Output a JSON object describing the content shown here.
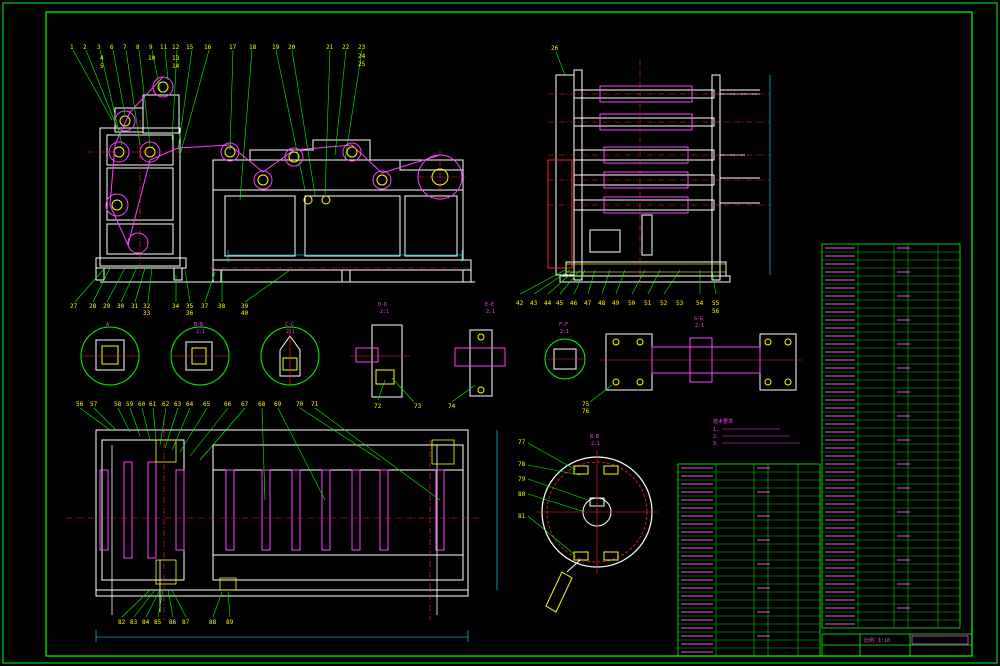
{
  "colors": {
    "background": "#000000",
    "frame": "#00ff00",
    "part": "#ffffff",
    "center": "#ff2020",
    "leader": "#00ff00",
    "number": "#ffff00",
    "note": "#ff40ff",
    "table_text": "#ff40ff",
    "shaft": "#ff40ff",
    "bolt": "#ffff00",
    "dim": "#00ffff"
  },
  "front_view_numbers": [
    "1",
    "2",
    "3",
    "4",
    "5",
    "6",
    "7",
    "8",
    "9",
    "10",
    "11",
    "12",
    "13",
    "14",
    "15",
    "16",
    "17",
    "18",
    "19",
    "20",
    "21",
    "22",
    "23",
    "24",
    "25"
  ],
  "front_view_bottom_numbers": [
    "27",
    "28",
    "29",
    "30",
    "31",
    "32",
    "33",
    "34",
    "35",
    "36",
    "37",
    "38",
    "39",
    "40"
  ],
  "side_view_number": "26",
  "side_view_bottom_numbers": [
    "42",
    "43",
    "44",
    "45",
    "46",
    "47",
    "48",
    "49",
    "50",
    "51",
    "52",
    "53",
    "54",
    "55",
    "56"
  ],
  "detail_views": [
    {
      "label": "A",
      "scale": "2:1"
    },
    {
      "label": "B-B",
      "scale": "2:1"
    },
    {
      "label": "C-C",
      "scale": "2:1"
    },
    {
      "label": "D-D",
      "scale": "2:1"
    },
    {
      "label": "E-E",
      "scale": "2:1"
    },
    {
      "label": "F-F",
      "scale": "2:1"
    },
    {
      "label": "G-G",
      "scale": "2:1"
    }
  ],
  "detail_numbers": [
    "72",
    "73",
    "74",
    "75",
    "76"
  ],
  "top_view_numbers": [
    "56",
    "57",
    "58",
    "59",
    "60",
    "61",
    "62",
    "63",
    "64",
    "65",
    "66",
    "67",
    "68",
    "69",
    "70",
    "71"
  ],
  "top_view_bottom_numbers": [
    "82",
    "83",
    "84",
    "85",
    "86",
    "87",
    "88",
    "89"
  ],
  "section_view": {
    "label": "B-B",
    "scale": "2:1",
    "numbers": [
      "77",
      "78",
      "79",
      "80",
      "81"
    ]
  },
  "notes_title": "技术要求",
  "notes": [
    "1.",
    "2.",
    "3."
  ],
  "title_block": {
    "label1": "比例",
    "label2": "1:10"
  }
}
